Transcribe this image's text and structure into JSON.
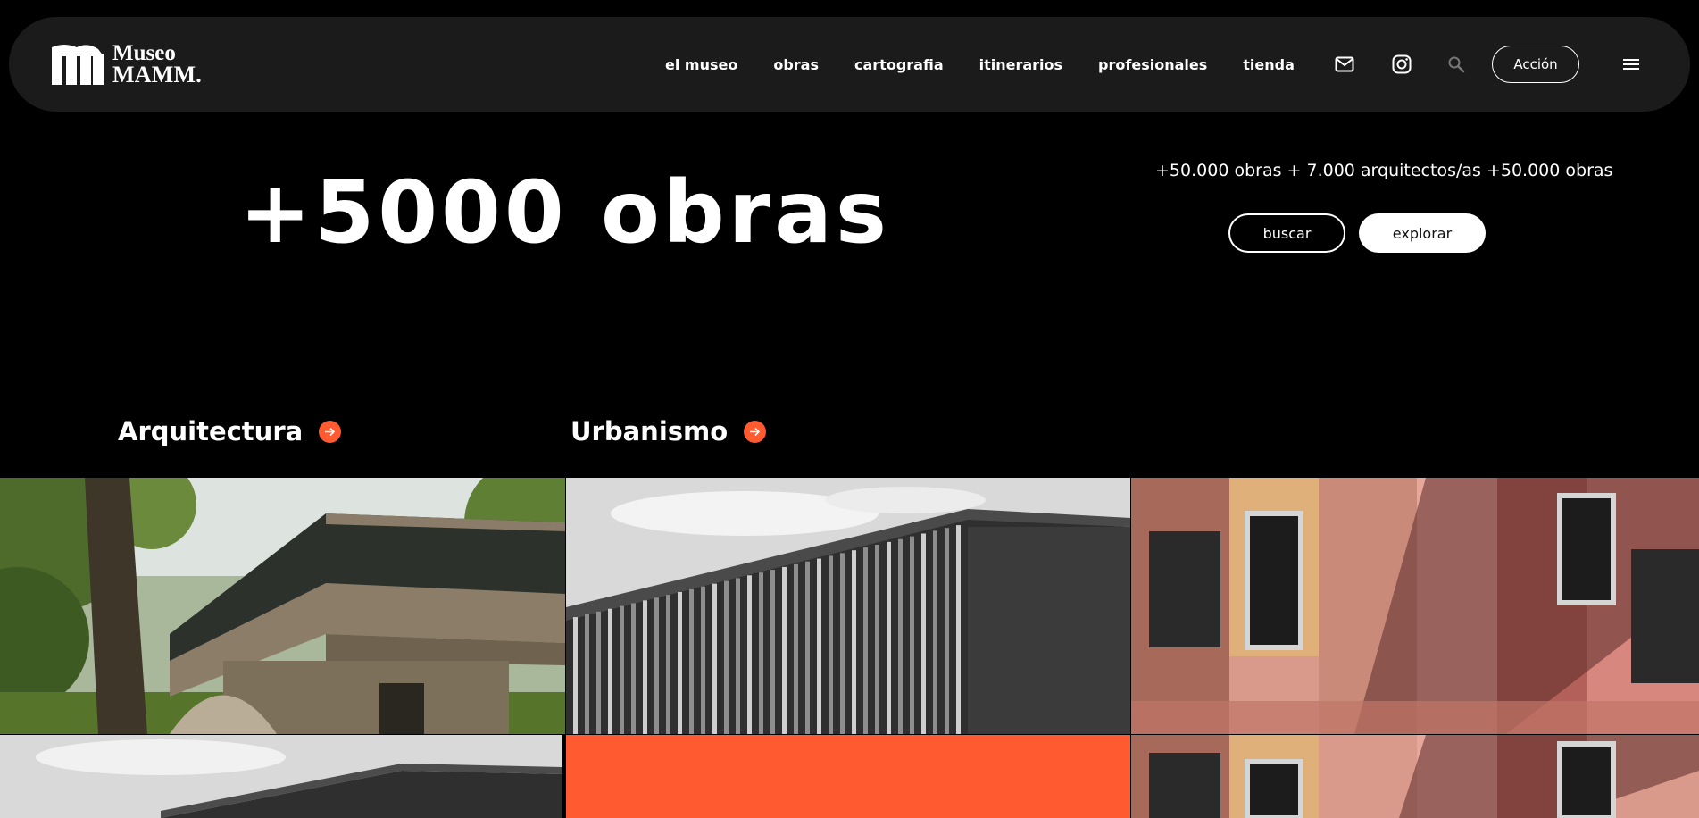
{
  "brand": {
    "logo_line1": "Museo",
    "logo_line2": "MAMM."
  },
  "nav": {
    "links": [
      "el museo",
      "obras",
      "cartografia",
      "itinerarios",
      "profesionales",
      "tienda"
    ],
    "action_label": "Acción",
    "icons": [
      "mail-icon",
      "instagram-icon",
      "search-icon",
      "menu-icon"
    ]
  },
  "hero": {
    "title": "+5000 obras",
    "stats": "+50.000 obras + 7.000 arquitectos/as +50.000 obras",
    "buscar_label": "buscar",
    "explorar_label": "explorar"
  },
  "categories": [
    "Arquitectura",
    "Urbanismo"
  ],
  "colors": {
    "accent": "#ff5a30",
    "nav_bg": "#1b1b1b",
    "page_bg": "#000000"
  }
}
